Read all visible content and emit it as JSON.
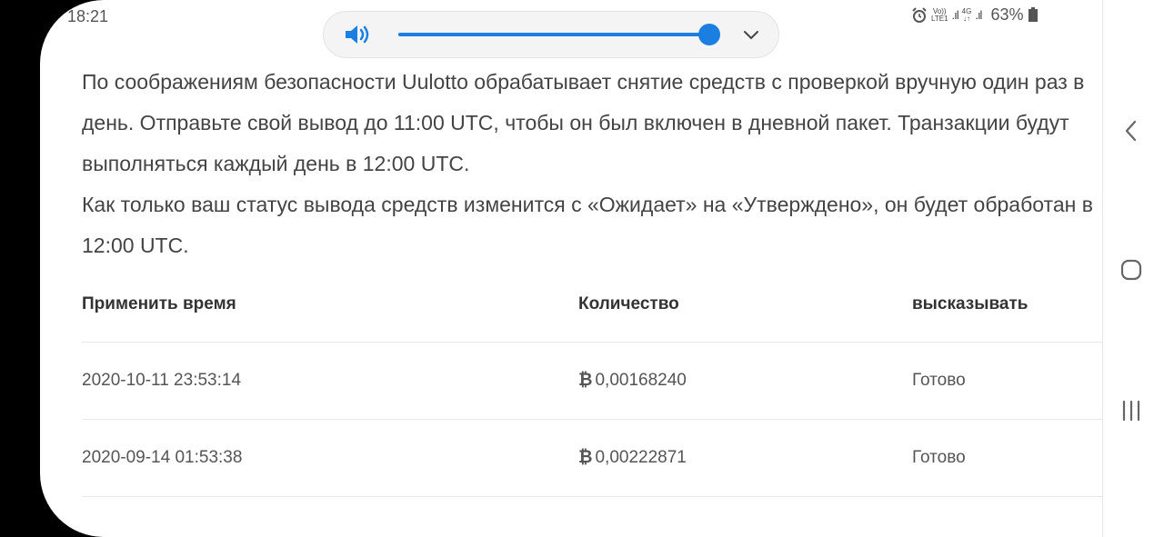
{
  "status_bar": {
    "time": "18:21",
    "network_tag_top": "Vo))",
    "network_tag_bottom": "LTE1",
    "network_4g": "4G",
    "battery": "63%"
  },
  "volume_panel": {
    "level": 1.0,
    "speaker_icon": "speaker-icon",
    "expand_icon": "chevron-down-icon"
  },
  "content": {
    "paragraph1": "По соображениям безопасности Uulotto обрабатывает снятие средств с проверкой вручную один раз в день. Отправьте свой вывод до 11:00 UTC, чтобы он был включен в дневной пакет. Транзакции будут выполняться каждый день в 12:00 UTC.",
    "paragraph2": "Как только ваш статус вывода средств изменится с «Ожидает» на «Утверждено», он будет обработан в 12:00 UTC."
  },
  "table": {
    "headers": [
      "Применить время",
      "Количество",
      "высказывать"
    ],
    "currency_symbol": "₿",
    "rows": [
      {
        "time": "2020-10-11 23:53:14",
        "amount": "0,00168240",
        "status": "Готово"
      },
      {
        "time": "2020-09-14 01:53:38",
        "amount": "0,00222871",
        "status": "Готово"
      }
    ]
  },
  "navigation": {
    "back_icon": "back-icon",
    "home_icon": "home-icon",
    "recent_icon": "recent-apps-icon"
  },
  "colors": {
    "accent": "#1a7fe0",
    "text": "#444444"
  }
}
